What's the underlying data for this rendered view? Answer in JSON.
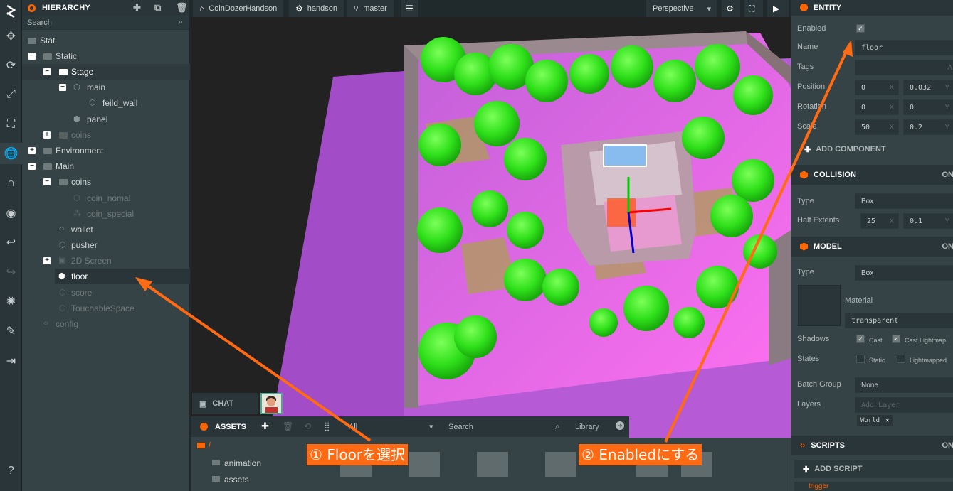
{
  "hierarchy": {
    "title": "HIERARCHY",
    "search_placeholder": "Search",
    "items": [
      "Stat",
      "Static",
      "Stage",
      "main",
      "feild_wall",
      "panel",
      "coins",
      "Environment",
      "Main",
      "coins",
      "coin_nomal",
      "coin_special",
      "wallet",
      "pusher",
      "2D Screen",
      "floor",
      "score",
      "TouchableSpace",
      "config"
    ]
  },
  "viewport": {
    "project": "CoinDozerHandson",
    "user": "handson",
    "branch": "master",
    "camera": "Perspective"
  },
  "chat": {
    "label": "CHAT"
  },
  "assets": {
    "title": "ASSETS",
    "filter": "All",
    "search_placeholder": "Search",
    "library": "Library",
    "path": "/",
    "folders": [
      "animation",
      "assets"
    ]
  },
  "entity": {
    "title": "ENTITY",
    "enabled_label": "Enabled",
    "name_label": "Name",
    "name_value": "floor",
    "tags_label": "Tags",
    "position_label": "Position",
    "position": [
      "0",
      "0.032"
    ],
    "rotation_label": "Rotation",
    "rotation": [
      "0",
      "0"
    ],
    "scale_label": "Scale",
    "scale": [
      "50",
      "0.2"
    ],
    "add_component": "ADD COMPONENT"
  },
  "collision": {
    "title": "COLLISION",
    "on": "ON",
    "type_label": "Type",
    "type_value": "Box",
    "half_label": "Half Extents",
    "half": [
      "25",
      "0.1"
    ]
  },
  "model": {
    "title": "MODEL",
    "on": "ON",
    "type_label": "Type",
    "type_value": "Box",
    "material_label": "Material",
    "material_value": "transparent",
    "shadows_label": "Shadows",
    "cast": "Cast",
    "cast_lightmap": "Cast Lightmap",
    "states_label": "States",
    "static": "Static",
    "lightmapped": "Lightmapped",
    "batch_label": "Batch Group",
    "batch_value": "None",
    "layers_label": "Layers",
    "add_layer": "Add Layer",
    "layer_tag": "World"
  },
  "scripts": {
    "title": "SCRIPTS",
    "on": "ON",
    "add_script": "ADD SCRIPT",
    "item": "trigger"
  },
  "callouts": {
    "one": "① Floorを選択",
    "two": "② Enabledにする"
  },
  "colors": {
    "accent": "#ff6a13",
    "panel": "#364346",
    "header": "#293538"
  }
}
